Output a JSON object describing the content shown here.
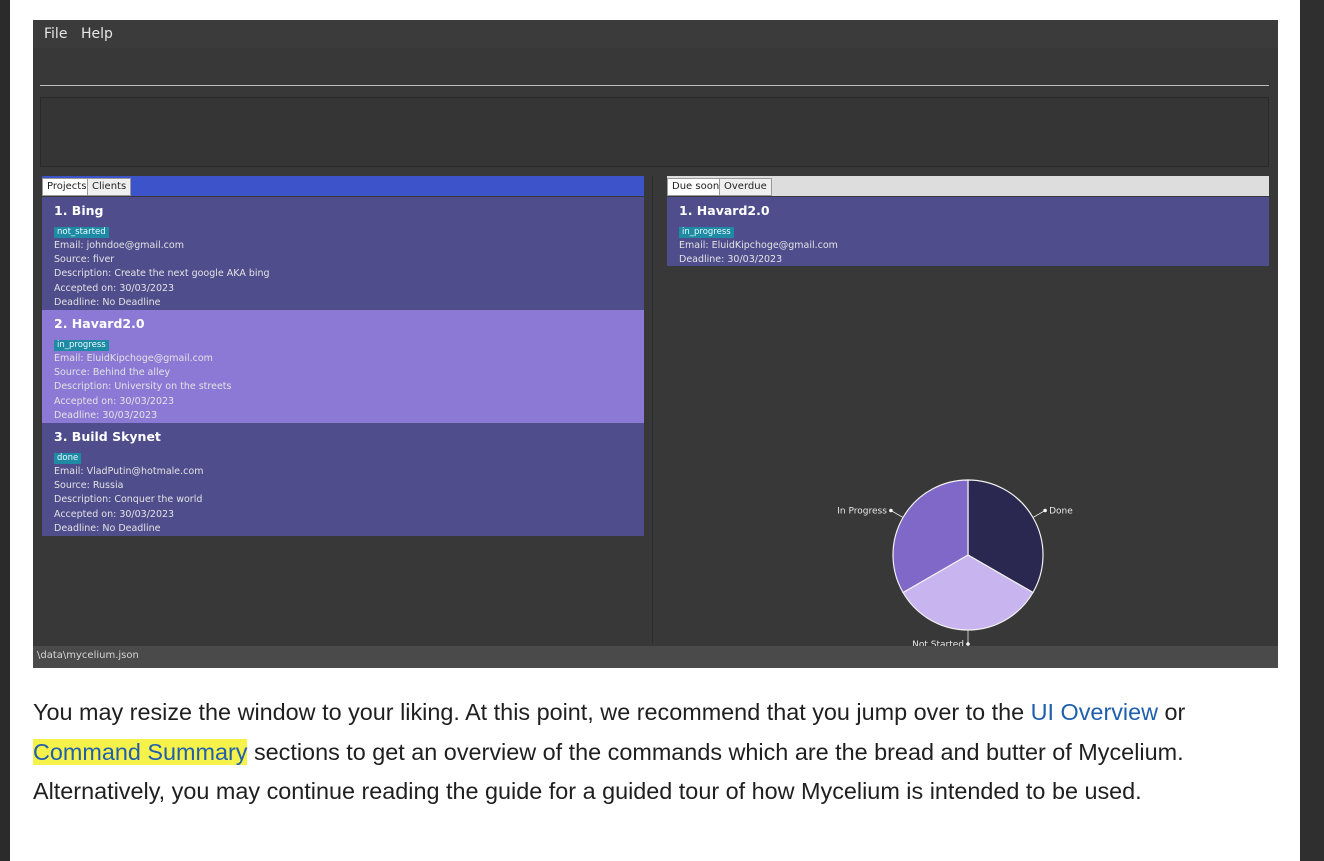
{
  "menu": {
    "file": "File",
    "help": "Help"
  },
  "left_panel": {
    "tabs": [
      "Projects",
      "Clients"
    ],
    "projects": [
      {
        "title": "1.  Bing",
        "status": "not_started",
        "lines": [
          "Email: johndoe@gmail.com",
          "Source: fiver",
          "Description: Create the next google AKA bing",
          "Accepted on: 30/03/2023",
          "Deadline: No Deadline"
        ]
      },
      {
        "title": "2.  Havard2.0",
        "status": "in_progress",
        "lines": [
          "Email: EluidKipchoge@gmail.com",
          "Source: Behind the alley",
          "Description: University on the streets",
          "Accepted on: 30/03/2023",
          "Deadline: 30/03/2023"
        ]
      },
      {
        "title": "3.  Build Skynet",
        "status": "done",
        "lines": [
          "Email: VladPutin@hotmale.com",
          "Source: Russia",
          "Description: Conquer the world",
          "Accepted on: 30/03/2023",
          "Deadline: No Deadline"
        ]
      }
    ]
  },
  "right_panel": {
    "tabs": [
      "Due soon",
      "Overdue"
    ],
    "items": [
      {
        "title": "1.  Havard2.0",
        "status": "in_progress",
        "lines": [
          "Email: EluidKipchoge@gmail.com",
          "Deadline: 30/03/2023"
        ]
      }
    ]
  },
  "chart_data": {
    "type": "pie",
    "slices": [
      {
        "label": "Done",
        "value": 1,
        "color": "#2a2850"
      },
      {
        "label": "Not Started",
        "value": 1,
        "color": "#c8b4ee"
      },
      {
        "label": "In Progress",
        "value": 1,
        "color": "#8068c8"
      }
    ]
  },
  "status_bar": {
    "path": "\\data\\mycelium.json"
  },
  "paragraph": {
    "t1": "You may resize the window to your liking. At this point, we recommend that you jump over to the ",
    "link1": "UI Overview",
    "t2": " or ",
    "link2": "Command Summary",
    "t3": " sections to get an overview of the commands which are the bread and butter of Mycelium. Alternatively, you may continue reading the guide for a guided tour of how Mycelium is intended to be used."
  }
}
